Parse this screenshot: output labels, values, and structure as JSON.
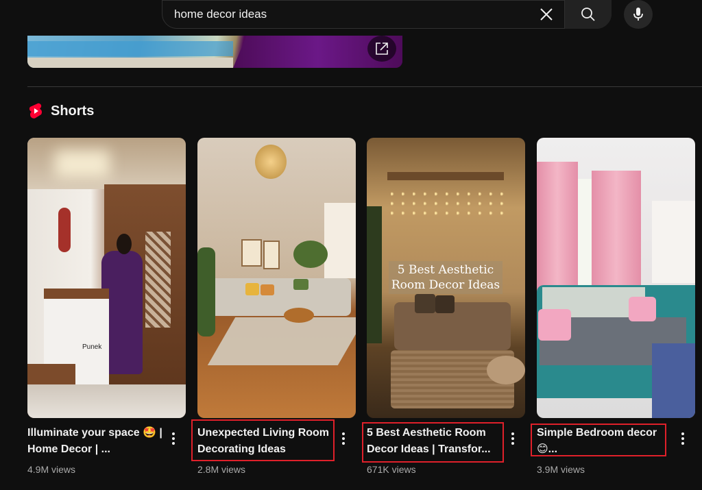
{
  "search": {
    "query": "home decor ideas"
  },
  "section": {
    "title": "Shorts"
  },
  "shorts": [
    {
      "title": "Illuminate your space 🤩 | Home Decor | ...",
      "views": "4.9M views"
    },
    {
      "title": "Unexpected Living Room Decorating Ideas",
      "views": "2.8M views"
    },
    {
      "title": "5 Best Aesthetic Room Decor Ideas | Transfor...",
      "views": "671K views",
      "overlay": "5 Best Aesthetic Room Decor Ideas"
    },
    {
      "title": "Simple Bedroom decor 😊...",
      "views": "3.9M views"
    }
  ],
  "thumb1": {
    "brand": "Punek"
  },
  "colors": {
    "background": "#0f0f0f",
    "shorts_red": "#ff0033",
    "highlight_red": "#e0202a",
    "text_secondary": "#aaaaaa"
  }
}
